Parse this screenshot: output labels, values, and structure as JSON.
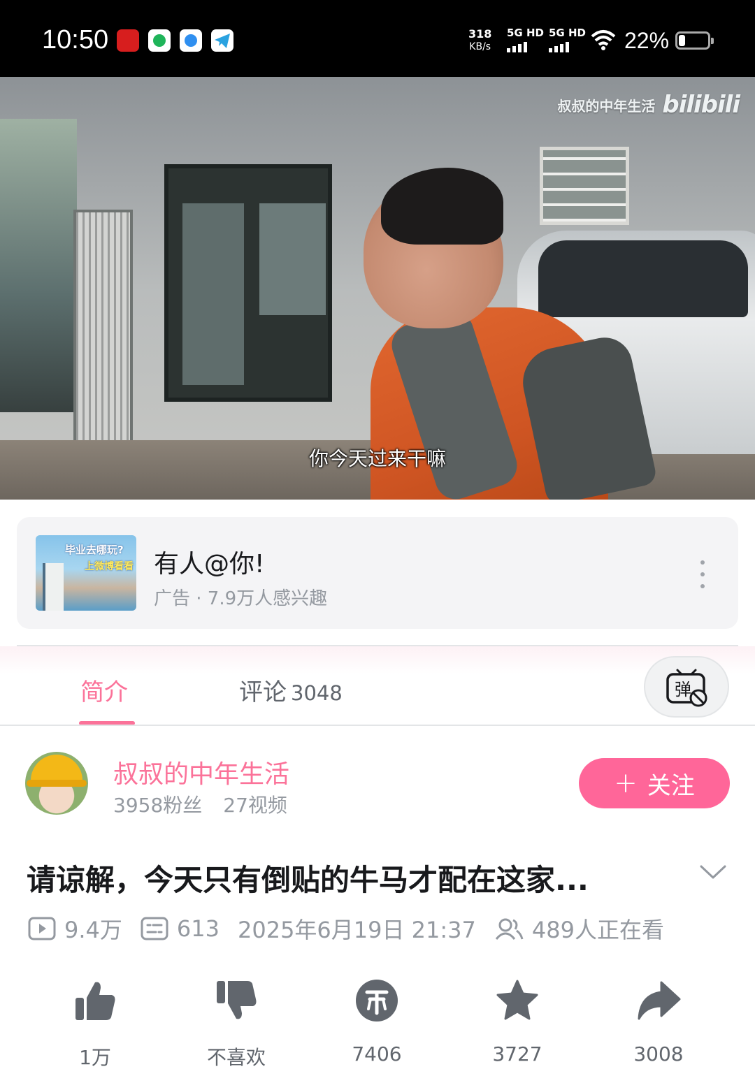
{
  "status_bar": {
    "time": "10:50",
    "net_speed_value": "318",
    "net_speed_unit": "KB/s",
    "sim1": "5G HD",
    "sim2": "5G HD",
    "battery_percent": "22%",
    "battery_level": 0.22
  },
  "video": {
    "watermark_text": "叔叔的中年生活",
    "watermark_logo": "bilibili",
    "subtitle": "你今天过来干嘛"
  },
  "ad": {
    "title": "有人@你!",
    "subtitle": "广告 · 7.9万人感兴趣",
    "thumb_text_1": "毕业去哪玩?",
    "thumb_text_2": "上微博看看"
  },
  "tabs": {
    "intro_label": "简介",
    "comments_label": "评论",
    "comments_count": "3048",
    "danmu_icon": "danmaku-off-icon"
  },
  "uploader": {
    "name": "叔叔的中年生活",
    "fans": "3958粉丝",
    "videos": "27视频",
    "follow_label": "关注"
  },
  "video_info": {
    "title": "请谅解，今天只有倒贴的牛马才配在这家...",
    "views": "9.4万",
    "danmaku": "613",
    "published": "2025年6月19日 21:37",
    "watching": "489人正在看"
  },
  "actions": {
    "like": "1万",
    "dislike": "不喜欢",
    "coin": "7406",
    "favorite": "3727",
    "share": "3008"
  },
  "colors": {
    "brand_pink": "#fb7299",
    "follow_pink": "#ff6699",
    "icon_gray": "#61666d"
  }
}
